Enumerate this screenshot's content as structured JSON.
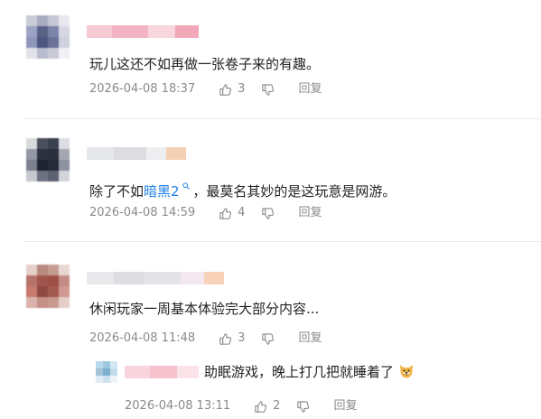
{
  "comments": [
    {
      "text": "玩儿这还不如再做一张卷子来的有趣。",
      "time": "2026-04-08 18:37",
      "likes": "3",
      "reply_label": "回复"
    },
    {
      "text_before": "除了不如",
      "link_text": "暗黑2",
      "text_after": "，最莫名其妙的是这玩意是网游。",
      "time": "2026-04-08 14:59",
      "likes": "4",
      "reply_label": "回复"
    },
    {
      "text": "休闲玩家一周基本体验完大部分内容...",
      "time": "2026-04-08 11:48",
      "likes": "3",
      "reply_label": "回复",
      "reply": {
        "text": "助眠游戏，晚上打几把就睡着了",
        "time": "2026-04-08 13:11",
        "likes": "2",
        "reply_label": "回复"
      }
    }
  ],
  "colors": {
    "link": "#2080e8",
    "meta": "#8a8a8a",
    "text": "#222222"
  },
  "icons": [
    "thumbs-up-icon",
    "thumbs-down-icon",
    "search-icon",
    "dog-face-emoji"
  ]
}
